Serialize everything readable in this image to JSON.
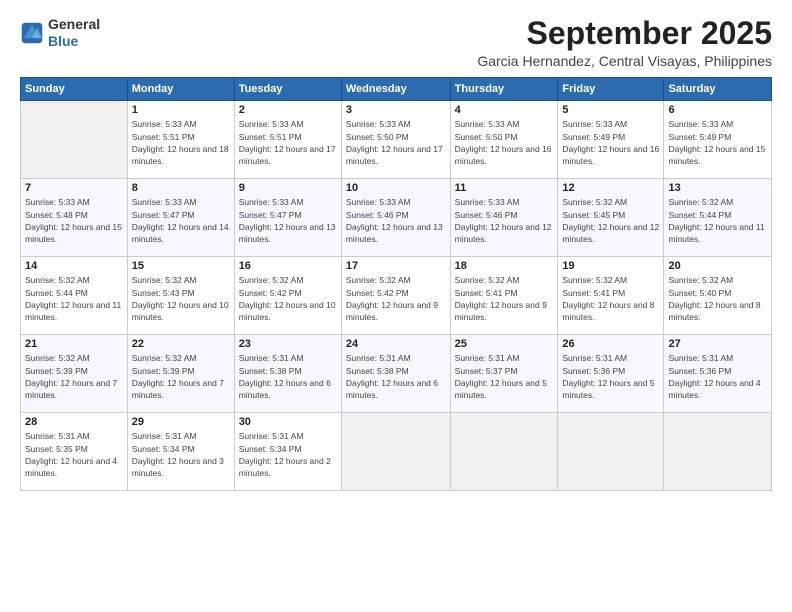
{
  "logo": {
    "text_general": "General",
    "text_blue": "Blue"
  },
  "header": {
    "month": "September 2025",
    "location": "Garcia Hernandez, Central Visayas, Philippines"
  },
  "weekdays": [
    "Sunday",
    "Monday",
    "Tuesday",
    "Wednesday",
    "Thursday",
    "Friday",
    "Saturday"
  ],
  "weeks": [
    [
      {
        "day": "",
        "sunrise": "",
        "sunset": "",
        "daylight": ""
      },
      {
        "day": "1",
        "sunrise": "Sunrise: 5:33 AM",
        "sunset": "Sunset: 5:51 PM",
        "daylight": "Daylight: 12 hours and 18 minutes."
      },
      {
        "day": "2",
        "sunrise": "Sunrise: 5:33 AM",
        "sunset": "Sunset: 5:51 PM",
        "daylight": "Daylight: 12 hours and 17 minutes."
      },
      {
        "day": "3",
        "sunrise": "Sunrise: 5:33 AM",
        "sunset": "Sunset: 5:50 PM",
        "daylight": "Daylight: 12 hours and 17 minutes."
      },
      {
        "day": "4",
        "sunrise": "Sunrise: 5:33 AM",
        "sunset": "Sunset: 5:50 PM",
        "daylight": "Daylight: 12 hours and 16 minutes."
      },
      {
        "day": "5",
        "sunrise": "Sunrise: 5:33 AM",
        "sunset": "Sunset: 5:49 PM",
        "daylight": "Daylight: 12 hours and 16 minutes."
      },
      {
        "day": "6",
        "sunrise": "Sunrise: 5:33 AM",
        "sunset": "Sunset: 5:49 PM",
        "daylight": "Daylight: 12 hours and 15 minutes."
      }
    ],
    [
      {
        "day": "7",
        "sunrise": "Sunrise: 5:33 AM",
        "sunset": "Sunset: 5:48 PM",
        "daylight": "Daylight: 12 hours and 15 minutes."
      },
      {
        "day": "8",
        "sunrise": "Sunrise: 5:33 AM",
        "sunset": "Sunset: 5:47 PM",
        "daylight": "Daylight: 12 hours and 14 minutes."
      },
      {
        "day": "9",
        "sunrise": "Sunrise: 5:33 AM",
        "sunset": "Sunset: 5:47 PM",
        "daylight": "Daylight: 12 hours and 13 minutes."
      },
      {
        "day": "10",
        "sunrise": "Sunrise: 5:33 AM",
        "sunset": "Sunset: 5:46 PM",
        "daylight": "Daylight: 12 hours and 13 minutes."
      },
      {
        "day": "11",
        "sunrise": "Sunrise: 5:33 AM",
        "sunset": "Sunset: 5:46 PM",
        "daylight": "Daylight: 12 hours and 12 minutes."
      },
      {
        "day": "12",
        "sunrise": "Sunrise: 5:32 AM",
        "sunset": "Sunset: 5:45 PM",
        "daylight": "Daylight: 12 hours and 12 minutes."
      },
      {
        "day": "13",
        "sunrise": "Sunrise: 5:32 AM",
        "sunset": "Sunset: 5:44 PM",
        "daylight": "Daylight: 12 hours and 11 minutes."
      }
    ],
    [
      {
        "day": "14",
        "sunrise": "Sunrise: 5:32 AM",
        "sunset": "Sunset: 5:44 PM",
        "daylight": "Daylight: 12 hours and 11 minutes."
      },
      {
        "day": "15",
        "sunrise": "Sunrise: 5:32 AM",
        "sunset": "Sunset: 5:43 PM",
        "daylight": "Daylight: 12 hours and 10 minutes."
      },
      {
        "day": "16",
        "sunrise": "Sunrise: 5:32 AM",
        "sunset": "Sunset: 5:42 PM",
        "daylight": "Daylight: 12 hours and 10 minutes."
      },
      {
        "day": "17",
        "sunrise": "Sunrise: 5:32 AM",
        "sunset": "Sunset: 5:42 PM",
        "daylight": "Daylight: 12 hours and 9 minutes."
      },
      {
        "day": "18",
        "sunrise": "Sunrise: 5:32 AM",
        "sunset": "Sunset: 5:41 PM",
        "daylight": "Daylight: 12 hours and 9 minutes."
      },
      {
        "day": "19",
        "sunrise": "Sunrise: 5:32 AM",
        "sunset": "Sunset: 5:41 PM",
        "daylight": "Daylight: 12 hours and 8 minutes."
      },
      {
        "day": "20",
        "sunrise": "Sunrise: 5:32 AM",
        "sunset": "Sunset: 5:40 PM",
        "daylight": "Daylight: 12 hours and 8 minutes."
      }
    ],
    [
      {
        "day": "21",
        "sunrise": "Sunrise: 5:32 AM",
        "sunset": "Sunset: 5:39 PM",
        "daylight": "Daylight: 12 hours and 7 minutes."
      },
      {
        "day": "22",
        "sunrise": "Sunrise: 5:32 AM",
        "sunset": "Sunset: 5:39 PM",
        "daylight": "Daylight: 12 hours and 7 minutes."
      },
      {
        "day": "23",
        "sunrise": "Sunrise: 5:31 AM",
        "sunset": "Sunset: 5:38 PM",
        "daylight": "Daylight: 12 hours and 6 minutes."
      },
      {
        "day": "24",
        "sunrise": "Sunrise: 5:31 AM",
        "sunset": "Sunset: 5:38 PM",
        "daylight": "Daylight: 12 hours and 6 minutes."
      },
      {
        "day": "25",
        "sunrise": "Sunrise: 5:31 AM",
        "sunset": "Sunset: 5:37 PM",
        "daylight": "Daylight: 12 hours and 5 minutes."
      },
      {
        "day": "26",
        "sunrise": "Sunrise: 5:31 AM",
        "sunset": "Sunset: 5:36 PM",
        "daylight": "Daylight: 12 hours and 5 minutes."
      },
      {
        "day": "27",
        "sunrise": "Sunrise: 5:31 AM",
        "sunset": "Sunset: 5:36 PM",
        "daylight": "Daylight: 12 hours and 4 minutes."
      }
    ],
    [
      {
        "day": "28",
        "sunrise": "Sunrise: 5:31 AM",
        "sunset": "Sunset: 5:35 PM",
        "daylight": "Daylight: 12 hours and 4 minutes."
      },
      {
        "day": "29",
        "sunrise": "Sunrise: 5:31 AM",
        "sunset": "Sunset: 5:34 PM",
        "daylight": "Daylight: 12 hours and 3 minutes."
      },
      {
        "day": "30",
        "sunrise": "Sunrise: 5:31 AM",
        "sunset": "Sunset: 5:34 PM",
        "daylight": "Daylight: 12 hours and 2 minutes."
      },
      {
        "day": "",
        "sunrise": "",
        "sunset": "",
        "daylight": ""
      },
      {
        "day": "",
        "sunrise": "",
        "sunset": "",
        "daylight": ""
      },
      {
        "day": "",
        "sunrise": "",
        "sunset": "",
        "daylight": ""
      },
      {
        "day": "",
        "sunrise": "",
        "sunset": "",
        "daylight": ""
      }
    ]
  ]
}
